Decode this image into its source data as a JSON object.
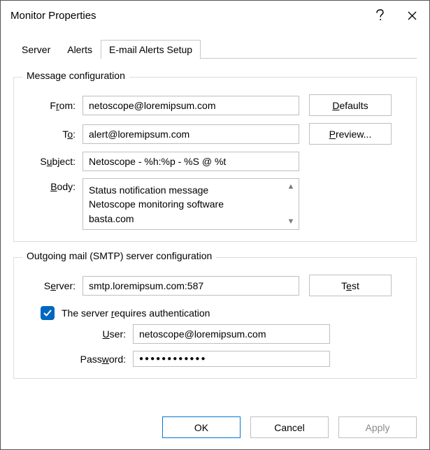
{
  "window": {
    "title": "Monitor Properties"
  },
  "tabs": {
    "server": "Server",
    "alerts": "Alerts",
    "email": "E-mail Alerts Setup"
  },
  "msg": {
    "group_title": "Message configuration",
    "from_label_pre": "F",
    "from_label_u": "r",
    "from_label_post": "om:",
    "from_value": "netoscope@loremipsum.com",
    "to_label_pre": "T",
    "to_label_u": "o",
    "to_label_post": ":",
    "to_value": "alert@loremipsum.com",
    "subj_label_pre": "S",
    "subj_label_u": "u",
    "subj_label_post": "bject:",
    "subj_value": "Netoscope - %h:%p - %S @ %t",
    "body_label_pre": "",
    "body_label_u": "B",
    "body_label_post": "ody:",
    "body_value": "Status notification message\nNetoscope monitoring software\nbasta.com",
    "defaults_pre": "",
    "defaults_u": "D",
    "defaults_post": "efaults",
    "preview_pre": "",
    "preview_u": "P",
    "preview_post": "review..."
  },
  "smtp": {
    "group_title": "Outgoing mail (SMTP) server configuration",
    "server_label_pre": "S",
    "server_label_u": "e",
    "server_label_post": "rver:",
    "server_value": "smtp.loremipsum.com:587",
    "test_pre": "T",
    "test_u": "e",
    "test_post": "st",
    "auth_pre": "The server ",
    "auth_u": "r",
    "auth_post": "equires authentication",
    "auth_checked": true,
    "user_label_pre": "",
    "user_label_u": "U",
    "user_label_post": "ser:",
    "user_value": "netoscope@loremipsum.com",
    "pass_label_pre": "Pass",
    "pass_label_u": "w",
    "pass_label_post": "ord:",
    "pass_value": "●●●●●●●●●●●●"
  },
  "buttons": {
    "ok": "OK",
    "cancel": "Cancel",
    "apply": "Apply"
  }
}
